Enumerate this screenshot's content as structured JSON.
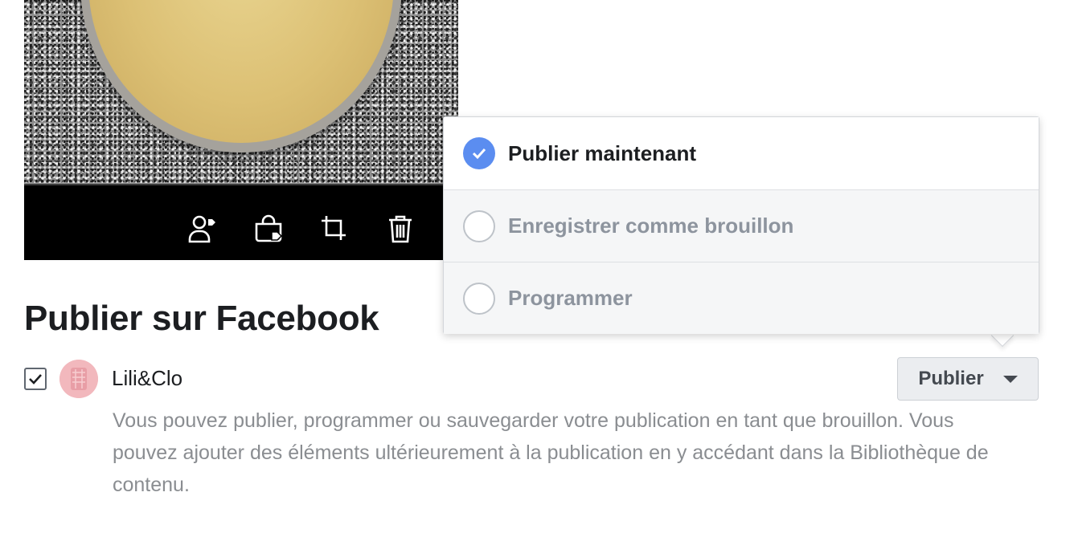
{
  "photo_toolbar": {
    "icons": [
      "tag-person-icon",
      "shopping-bag-tag-icon",
      "crop-icon",
      "trash-icon"
    ]
  },
  "section": {
    "title": "Publier sur Facebook"
  },
  "account": {
    "checked": true,
    "name": "Lili&Clo",
    "help_text": "Vous pouvez publier, programmer ou sauvegarder votre publication en tant que brouillon. Vous pouvez ajouter des éléments ultérieurement à la publication en y accédant dans la Bibliothèque de contenu."
  },
  "publish_button": {
    "label": "Publier"
  },
  "publish_menu": {
    "options": [
      {
        "label": "Publier maintenant",
        "selected": true
      },
      {
        "label": "Enregistrer comme brouillon",
        "selected": false
      },
      {
        "label": "Programmer",
        "selected": false
      }
    ]
  },
  "colors": {
    "accent": "#5b8df0",
    "toolbar_bg": "#000000",
    "button_bg": "#ebedf0",
    "muted_text": "#8a8d91"
  }
}
